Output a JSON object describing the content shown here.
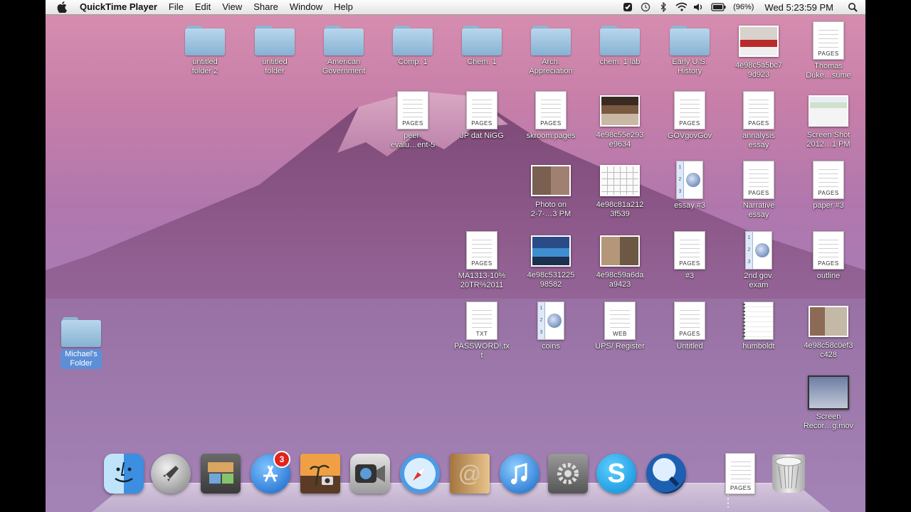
{
  "menubar": {
    "app_name": "QuickTime Player",
    "items": [
      "File",
      "Edit",
      "View",
      "Share",
      "Window",
      "Help"
    ],
    "battery": "(96%)",
    "clock": "Wed 5:23:59 PM"
  },
  "desktop": {
    "row1": [
      "untitled\nfolder 2",
      "untitled\nfolder",
      "American\nGovernment",
      "Comp. 1",
      "Chem. 1",
      "Arch.\nAppreciation",
      "chem. 1 lab",
      "Early U.S.\nHistory",
      "4e98c5a5bc7\n9d923",
      "Thomas\nDuke…sume"
    ],
    "row2": [
      "peer-\nevalu…ent-5",
      "JP dat NiGG",
      "skroom.pages",
      "4e98c55e293\ne9634",
      "GOVgovGov",
      "annalysis\nessay",
      "Screen Shot\n2012…1 PM"
    ],
    "row3": [
      "Photo on\n2-7-…3 PM",
      "4e98c81a212\n3f539",
      "essay #3",
      "Narrative\nessay",
      "paper #3"
    ],
    "row4": [
      "MA1313-10%\n20TR%2011",
      "4e98c531225\n98582",
      "4e98c59a6da\na9423",
      "#3",
      "2nd gov.\nexam",
      "outline"
    ],
    "row5": [
      "PASSWORD!.tx\nt",
      "coins",
      "UPS/ Register",
      "Untitled",
      "humboldt",
      "4e98c58c0ef3\nc428"
    ],
    "movie": "Screen\nRecor…g.mov",
    "michaels_folder": "Michael's\nFolder",
    "doc_tags": {
      "pages": "PAGES",
      "txt": "TXT",
      "web": "WEB"
    }
  },
  "dock": {
    "appstore_badge": "3",
    "doc_tag": "PAGES",
    "apps": [
      "finder",
      "launchpad",
      "preview",
      "app-store",
      "iphoto",
      "facetime",
      "safari",
      "address-book",
      "itunes",
      "system-preferences",
      "skype",
      "quicktime"
    ]
  },
  "colors": {
    "menubar": "#ececec",
    "folder": "#9cc4e4",
    "selection": "#5d8fd6"
  }
}
